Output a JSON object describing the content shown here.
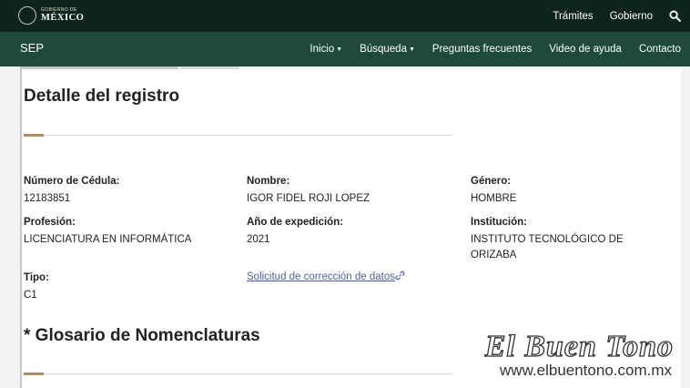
{
  "header": {
    "logo_small": "GOBIERNO DE",
    "logo_big": "MÉXICO",
    "links": [
      "Trámites",
      "Gobierno"
    ],
    "search_icon": "search-icon"
  },
  "nav": {
    "brand": "SEP",
    "items": [
      {
        "label": "Inicio",
        "dropdown": true
      },
      {
        "label": "Búsqueda",
        "dropdown": true
      },
      {
        "label": "Preguntas frecuentes",
        "dropdown": false
      },
      {
        "label": "Video de ayuda",
        "dropdown": false
      },
      {
        "label": "Contacto",
        "dropdown": false
      }
    ]
  },
  "page": {
    "title": "Detalle del registro",
    "fields": {
      "cedula": {
        "label": "Número de Cédula:",
        "value": "12183851"
      },
      "nombre": {
        "label": "Nombre:",
        "value": "IGOR FIDEL ROJI LOPEZ"
      },
      "genero": {
        "label": "Género:",
        "value": "HOMBRE"
      },
      "profesion": {
        "label": "Profesión:",
        "value": "LICENCIATURA EN INFORMÁTICA"
      },
      "anio": {
        "label": "Año de expedición:",
        "value": "2021"
      },
      "institucion": {
        "label": "Institución:",
        "value_line1": "INSTITUTO TECNOLÓGICO DE",
        "value_line2": "ORIZABA"
      },
      "tipo": {
        "label": "Tipo:",
        "value": "C1"
      }
    },
    "correction_link": "Solicitud de corrección de datos",
    "glossary_title": "* Glosario de Nomenclaturas"
  },
  "watermark": {
    "title": "El Buen Tono",
    "url": "www.elbuentono.com.mx"
  },
  "colors": {
    "topbar": "#0c231e",
    "navbar": "#1e4a3c",
    "accent": "#b38e5d",
    "link": "#4a5fa8"
  }
}
